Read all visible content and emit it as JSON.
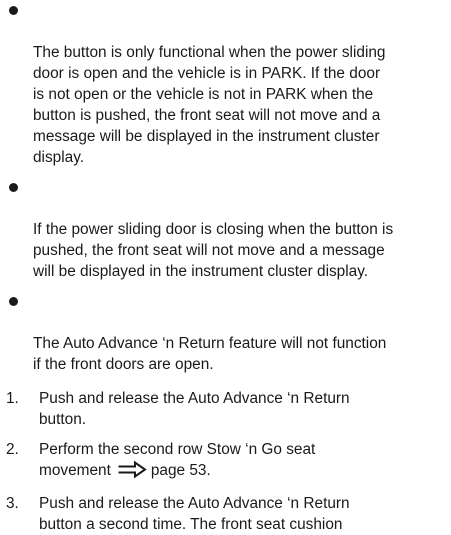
{
  "bullets": [
    {
      "text": "The button is only functional when the power sliding\ndoor is open and the vehicle is in PARK. If the door\nis not open or the vehicle is not in PARK when the\nbutton is pushed, the front seat will not move and a\nmessage will be displayed in the instrument cluster\ndisplay."
    },
    {
      "text": "If the power sliding door is closing when the button is\npushed, the front seat will not move and a message\nwill be displayed in the instrument cluster display."
    },
    {
      "text": "The Auto Advance ‘n Return feature will not function\nif the front doors are open."
    }
  ],
  "steps": [
    {
      "number": "1.",
      "text": "Push and release the Auto Advance ‘n Return\nbutton."
    },
    {
      "number": "2.",
      "text": "Perform the second row Stow ‘n Go seat\nmovement",
      "link_icon": "page-reference-arrow-icon",
      "link_text": "page 53."
    },
    {
      "number": "3.",
      "text": "Push and release the Auto Advance ‘n Return\nbutton a second time. The front seat cushion"
    }
  ]
}
